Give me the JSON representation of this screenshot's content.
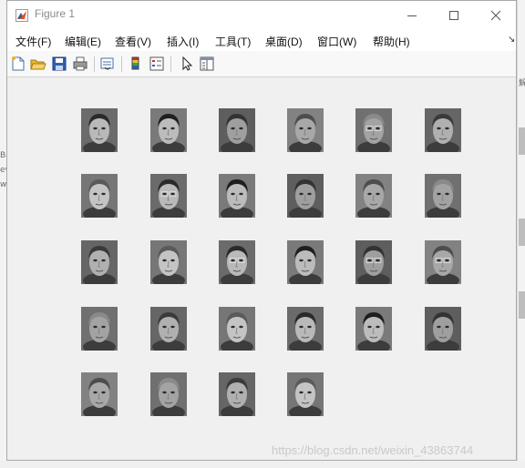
{
  "window": {
    "title": "Figure 1",
    "icon": "matlab-icon",
    "controls": [
      "minimize-icon",
      "maximize-icon",
      "close-icon"
    ]
  },
  "menu": {
    "items": [
      "文件(F)",
      "编辑(E)",
      "查看(V)",
      "插入(I)",
      "工具(T)",
      "桌面(D)",
      "窗口(W)",
      "帮助(H)"
    ],
    "dock_icon": "dock-arrow-icon"
  },
  "toolbar": {
    "icons": [
      "new-figure-icon",
      "open-file-icon",
      "save-icon",
      "print-icon",
      "link-plot-icon",
      "insert-colorbar-icon",
      "insert-legend-icon",
      "edit-plot-icon",
      "property-inspector-icon"
    ]
  },
  "figure": {
    "grid": {
      "rows": 5,
      "cols": 6
    },
    "face_count": 28,
    "colormap": "gray"
  },
  "background": {
    "left_fragments": [
      "Ba",
      "ev",
      "w"
    ],
    "right_fragments": [
      "解"
    ]
  },
  "watermark": "https://blog.csdn.net/weixin_43863744",
  "colors": {
    "titlebar": "#ffffff",
    "menubar": "#ffffff",
    "canvas": "#f0f0f0",
    "border": "#a9a9a9"
  }
}
